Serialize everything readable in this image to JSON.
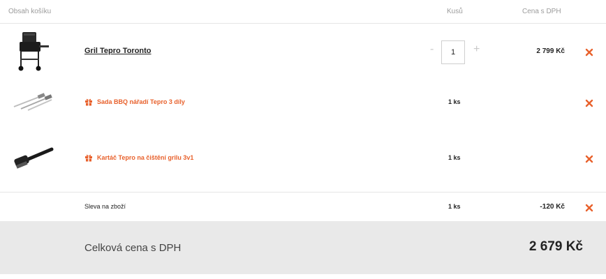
{
  "header": {
    "content_label": "Obsah košíku",
    "qty_label": "Kusů",
    "price_label": "Cena s DPH"
  },
  "items": [
    {
      "name": "Gril Tepro Toronto",
      "quantity": "1",
      "qty_minus": "-",
      "qty_plus": "+",
      "price": "2 799 Kč",
      "thumbnail": "grill-image"
    },
    {
      "name": "Sada BBQ nářadí Tepro 3 díly",
      "quantity": "1 ks",
      "gift_icon": "gift-icon",
      "thumbnail": "bbq-tools-image"
    },
    {
      "name": "Kartáč Tepro na čištění grilu 3v1",
      "quantity": "1 ks",
      "gift_icon": "gift-icon",
      "thumbnail": "grill-brush-image"
    },
    {
      "name": "Sleva na zboží",
      "quantity": "1 ks",
      "price": "-120 Kč"
    }
  ],
  "total": {
    "label": "Celková cena s DPH",
    "value": "2 679 Kč"
  },
  "colors": {
    "accent": "#e8612c",
    "total_bg": "#e9e9e9",
    "divider": "#e6e6e6"
  },
  "icons": {
    "remove": "close-icon",
    "gift": "gift-icon"
  }
}
